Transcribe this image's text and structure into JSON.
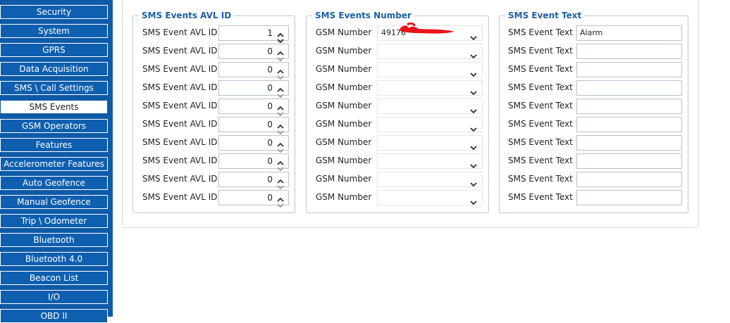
{
  "sidebar": {
    "items": [
      {
        "label": "Security",
        "active": false
      },
      {
        "label": "System",
        "active": false
      },
      {
        "label": "GPRS",
        "active": false
      },
      {
        "label": "Data Acquisition",
        "active": false
      },
      {
        "label": "SMS \\ Call Settings",
        "active": false
      },
      {
        "label": "SMS Events",
        "active": true
      },
      {
        "label": "GSM Operators",
        "active": false
      },
      {
        "label": "Features",
        "active": false
      },
      {
        "label": "Accelerometer Features",
        "active": false
      },
      {
        "label": "Auto Geofence",
        "active": false
      },
      {
        "label": "Manual Geofence",
        "active": false
      },
      {
        "label": "Trip \\ Odometer",
        "active": false
      },
      {
        "label": "Bluetooth",
        "active": false
      },
      {
        "label": "Bluetooth 4.0",
        "active": false
      },
      {
        "label": "Beacon List",
        "active": false
      },
      {
        "label": "I/O",
        "active": false
      },
      {
        "label": "OBD II",
        "active": false
      }
    ]
  },
  "groups": {
    "avl": {
      "title": "SMS Events AVL ID",
      "field_label": "SMS Event AVL ID",
      "values": [
        "1",
        "0",
        "0",
        "0",
        "0",
        "0",
        "0",
        "0",
        "0",
        "0"
      ],
      "up_icon": "spinner-up-icon",
      "down_icon": "spinner-down-icon"
    },
    "number": {
      "title": "SMS Events Number",
      "field_label": "GSM Number",
      "values": [
        "49176",
        "",
        "",
        "",
        "",
        "",
        "",
        "",
        "",
        ""
      ],
      "redacted_first": true,
      "chevron_icon": "chevron-down-icon"
    },
    "text": {
      "title": "SMS Event Text",
      "field_label": "SMS Event Text",
      "values": [
        "Alarm",
        "",
        "",
        "",
        "",
        "",
        "",
        "",
        "",
        ""
      ]
    }
  },
  "colors": {
    "sidebar_bg": "#0d5aa7",
    "legend_text": "#1c5fa8",
    "redaction": "#e8141c"
  }
}
